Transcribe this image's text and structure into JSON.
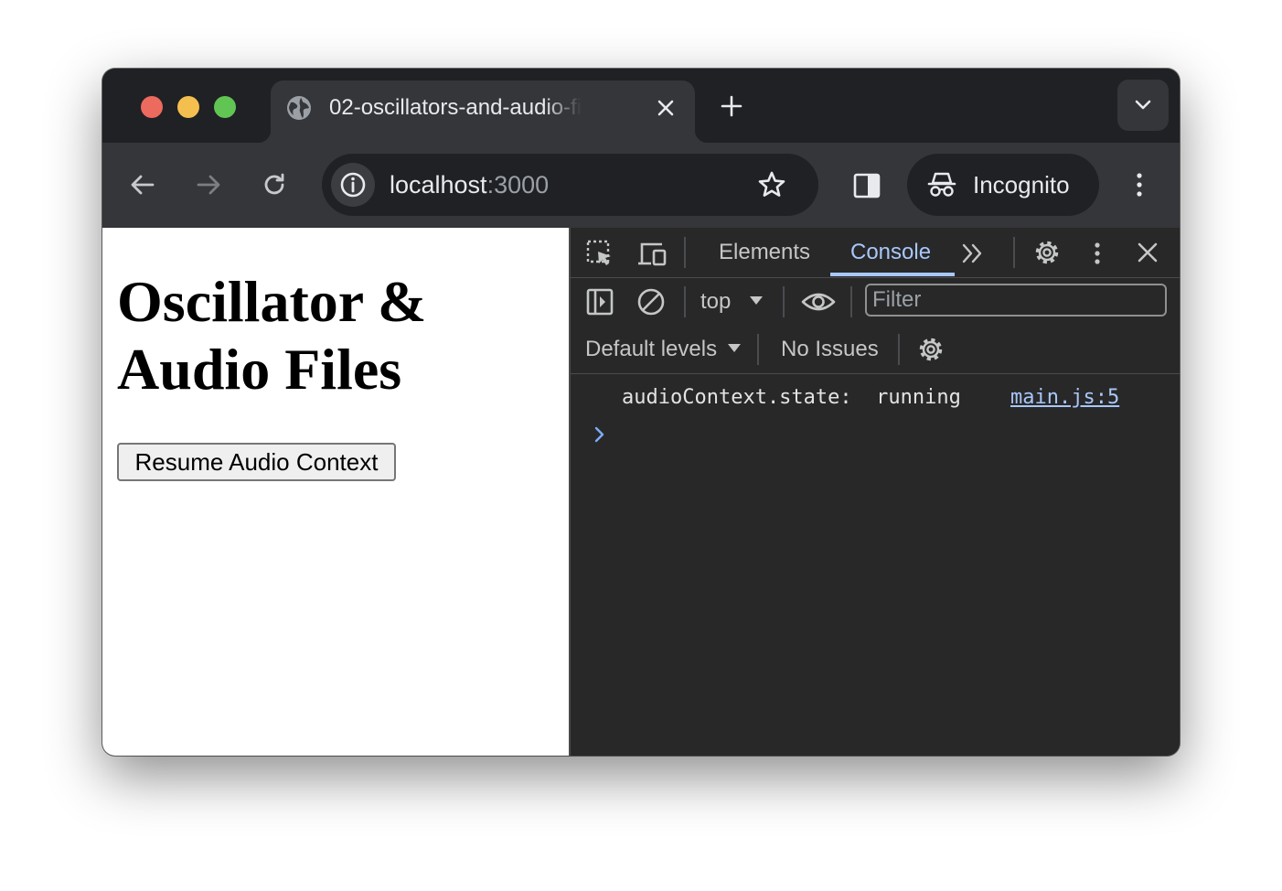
{
  "browser": {
    "tab": {
      "title": "02-oscillators-and-audio-files"
    },
    "omnibox": {
      "host": "localhost",
      "port": ":3000"
    },
    "profile": {
      "label": "Incognito"
    }
  },
  "page": {
    "heading": "Oscillator & Audio Files",
    "button_label": "Resume Audio Context"
  },
  "devtools": {
    "tabs": [
      "Elements",
      "Console"
    ],
    "active_tab": "Console",
    "context_selector": "top",
    "filter_placeholder": "Filter",
    "levels_label": "Default levels",
    "issues_label": "No Issues",
    "console": [
      {
        "message": "audioContext.state:  running",
        "source": "main.js:5"
      }
    ]
  },
  "colors": {
    "accent": "#a8c7fa",
    "window_frame": "#202124",
    "toolbar": "#35363a",
    "devtools_bg": "#282828"
  },
  "icons": [
    "globe-icon",
    "close-icon",
    "plus-icon",
    "chevron-down-icon",
    "back-arrow-icon",
    "forward-arrow-icon",
    "reload-icon",
    "info-icon",
    "star-icon",
    "side-panel-icon",
    "incognito-icon",
    "kebab-menu-icon",
    "inspect-element-icon",
    "device-toolbar-icon",
    "more-tabs-icon",
    "settings-icon",
    "sidebar-toggle-icon",
    "clear-console-icon",
    "eye-icon",
    "prompt-chevron-icon"
  ]
}
